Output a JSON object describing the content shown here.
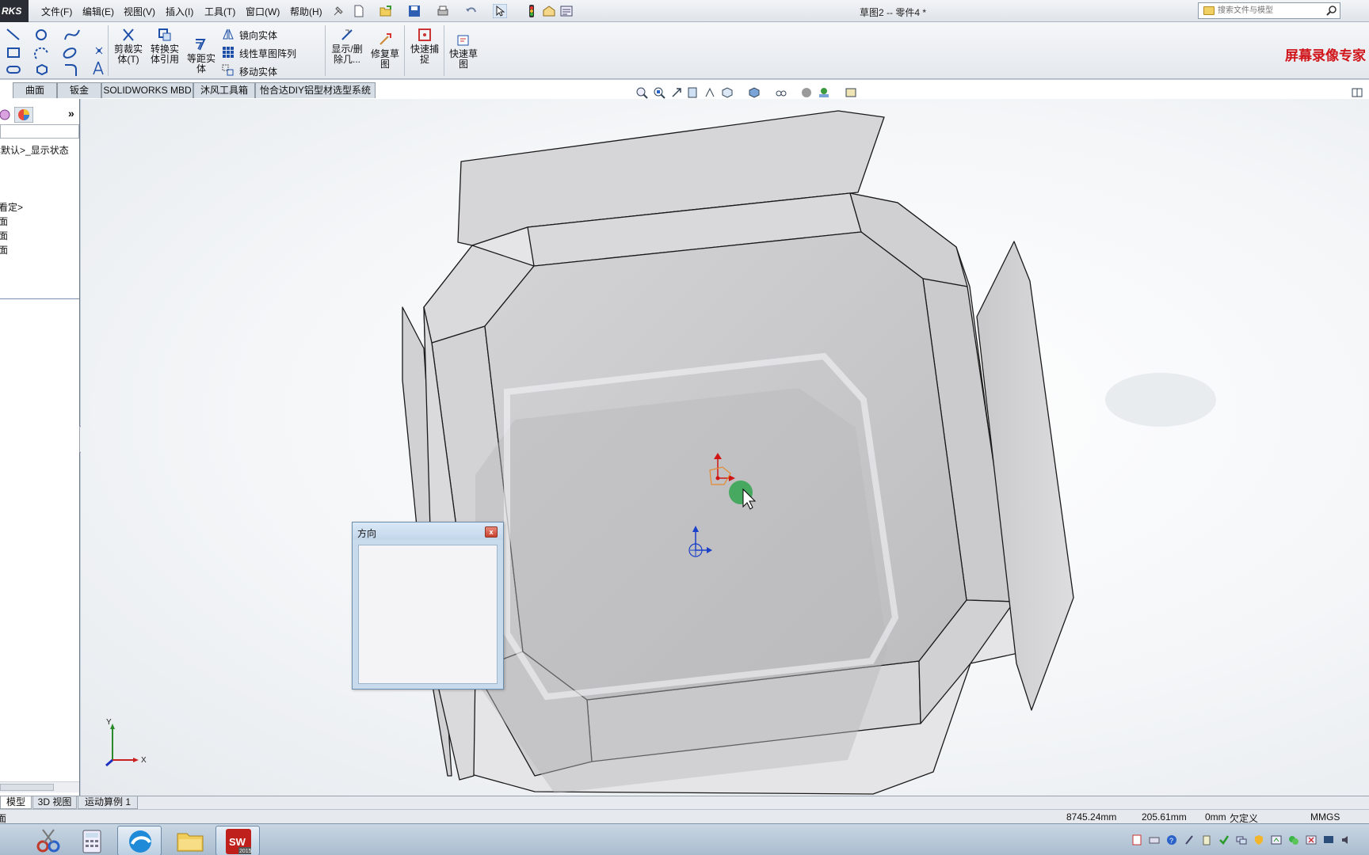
{
  "app": {
    "logo_text": "RKS",
    "title": "草图2 -- 零件4 *"
  },
  "menu": {
    "items": [
      "文件(F)",
      "编辑(E)",
      "视图(V)",
      "插入(I)",
      "工具(T)",
      "窗口(W)",
      "帮助(H)"
    ]
  },
  "search": {
    "placeholder": "搜索文件与模型"
  },
  "watermark": "屏幕录像专家",
  "sketch_toolbar": {
    "trim": "剪裁实\n体(T)",
    "convert": "转换实\n体引用",
    "offset": "等距实\n体",
    "mirror": "镜向实体",
    "linear_pattern": "线性草图阵列",
    "move": "移动实体",
    "show_delete": "显示/删\n除几...",
    "repair": "修复草\n图",
    "quick_snap": "快速捕\n捉",
    "rapid_sketch": "快速草\n图"
  },
  "cm_tabs": [
    "曲面",
    "钣金",
    "SOLIDWORKS MBD",
    "沐风工具箱",
    "怡合达DIY铝型材选型系统"
  ],
  "feature_tree": {
    "display_state": "<默认>_显示状态",
    "items": [
      "看定>",
      "面",
      "面",
      "面"
    ]
  },
  "dialog": {
    "title": "方向",
    "close_glyph": "x"
  },
  "triad": {
    "x": "X",
    "y": "Y"
  },
  "bottom_tabs": [
    "模型",
    "3D 视图",
    "运动算例 1"
  ],
  "status": {
    "left": "面",
    "x": "8745.24mm",
    "y": "205.61mm",
    "z": "0mm",
    "state": "欠定义",
    "units": "MMGS"
  },
  "taskbar": {
    "sw_label": "2015"
  },
  "colors": {
    "accent": "#2a62c9",
    "watermark": "#d0141a",
    "model_edge": "#1a1a1a",
    "model_face": "#cfcfd1"
  }
}
